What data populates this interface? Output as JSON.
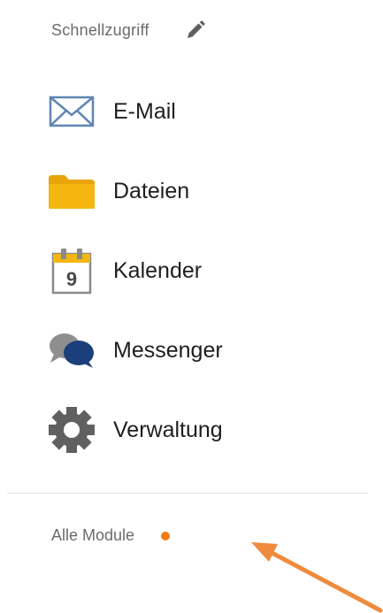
{
  "header": {
    "title": "Schnellzugriff",
    "edit_icon": "pencil-icon"
  },
  "items": [
    {
      "label": "E-Mail",
      "icon": "envelope-icon"
    },
    {
      "label": "Dateien",
      "icon": "folder-icon"
    },
    {
      "label": "Kalender",
      "icon": "calendar-icon",
      "calendar_day": "9"
    },
    {
      "label": "Messenger",
      "icon": "chat-bubbles-icon"
    },
    {
      "label": "Verwaltung",
      "icon": "gear-icon"
    }
  ],
  "footer": {
    "all_modules_label": "Alle Module",
    "notification_color": "#f07d12"
  },
  "colors": {
    "accent_orange": "#f07d12",
    "folder_yellow": "#f5b70f",
    "messenger_blue": "#1a3f7a"
  }
}
